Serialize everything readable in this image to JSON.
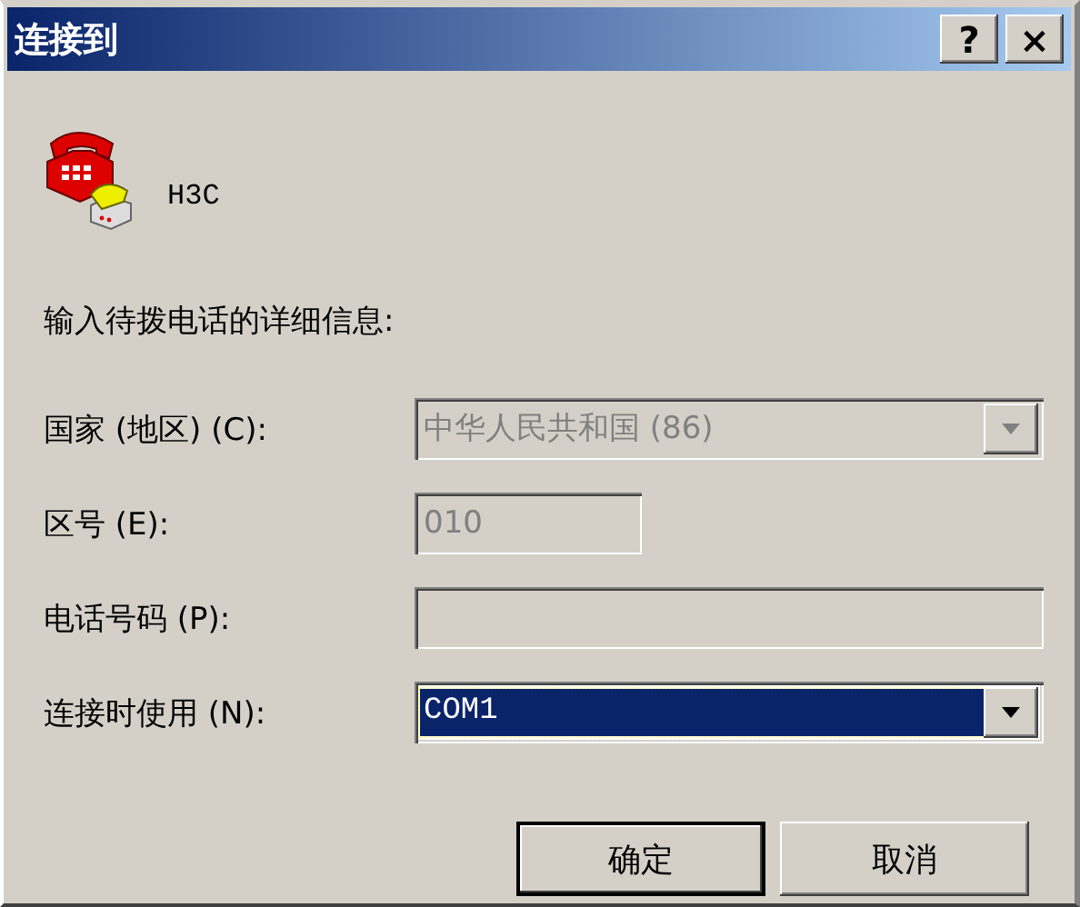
{
  "window": {
    "title": "连接到",
    "title_buttons": [
      "?",
      "×"
    ]
  },
  "connection": {
    "name": "H3C"
  },
  "instruction": "输入待拨电话的详细信息:",
  "fields": [
    {
      "kind": "combo",
      "label": "国家 (地区) (C):",
      "value": "中华人民共和国 (86)",
      "disabled": true
    },
    {
      "kind": "short_text",
      "label": "区号 (E):",
      "value": "010",
      "disabled": true
    },
    {
      "kind": "text",
      "label": "电话号码 (P):",
      "disabled": true
    },
    {
      "kind": "combo",
      "label": "连接时使用 (N):",
      "value": "COM1",
      "disabled": false,
      "selected": true
    }
  ],
  "buttons": [
    {
      "label": "确定",
      "default": true
    },
    {
      "label": "取消",
      "default": false
    }
  ]
}
